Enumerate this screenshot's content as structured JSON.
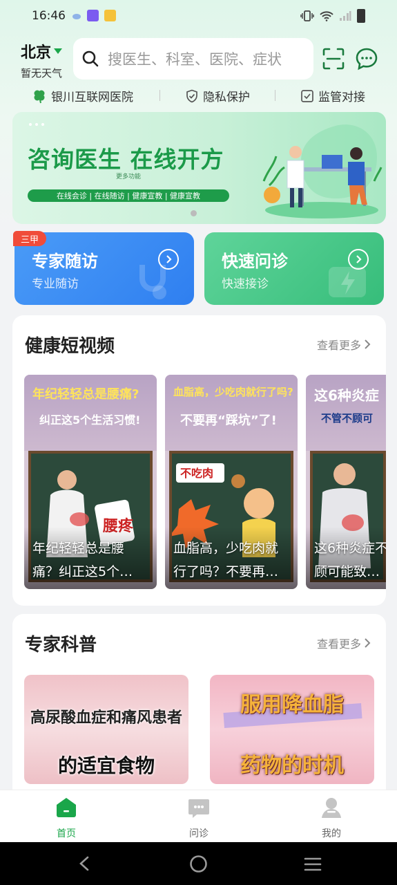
{
  "status_bar": {
    "time": "16:46",
    "right_icons": [
      "vibrate-icon",
      "wifi-icon",
      "signal-icon",
      "battery-icon"
    ]
  },
  "header": {
    "city": "北京",
    "weather": "暂无天气",
    "search_placeholder": "搜医生、科室、医院、症状"
  },
  "trust_bar": {
    "items": [
      {
        "label": "银川互联网医院",
        "icon": "clover-icon"
      },
      {
        "label": "隐私保护",
        "icon": "shield-check-icon"
      },
      {
        "label": "监管对接",
        "icon": "checkbox-icon"
      }
    ]
  },
  "banner": {
    "title": "咨询医生  在线开方",
    "more": "更多功能",
    "strip": "在线会诊 | 在线随访 | 健康宣教 | 健康宣教"
  },
  "feature_cards": {
    "badge": "三甲",
    "items": [
      {
        "title": "专家随访",
        "subtitle": "专业随访"
      },
      {
        "title": "快速问诊",
        "subtitle": "快速接诊"
      }
    ]
  },
  "health_videos": {
    "title": "健康短视频",
    "more": "查看更多",
    "items": [
      {
        "headline1": "年纪轻轻总是腰痛?",
        "headline2": "纠正这5个生活习惯!",
        "caption": "年纪轻轻总是腰痛？纠正这5个…"
      },
      {
        "headline1": "血脂高，少吃肉就行了吗?",
        "headline2": "不要再“踩坑”了!",
        "caption": "血脂高，少吃肉就行了吗？不要再…"
      },
      {
        "headline1": "这6种炎症",
        "headline2": "不管不顾可",
        "caption": "这6种炎症不顾可能致…"
      }
    ]
  },
  "expert_science": {
    "title": "专家科普",
    "more": "查看更多",
    "items": [
      {
        "line1": "高尿酸血症和痛风患者",
        "line2": "的适宜食物"
      },
      {
        "line1": "服用降血脂",
        "line2": "药物的时机"
      }
    ]
  },
  "bottom_nav": {
    "items": [
      {
        "label": "首页",
        "active": true
      },
      {
        "label": "问诊",
        "active": false
      },
      {
        "label": "我的",
        "active": false
      }
    ]
  },
  "colors": {
    "brand_green": "#1aa64a",
    "card_blue": "#3a8cf4",
    "card_green": "#45c483",
    "badge_red": "#f04c3a"
  }
}
